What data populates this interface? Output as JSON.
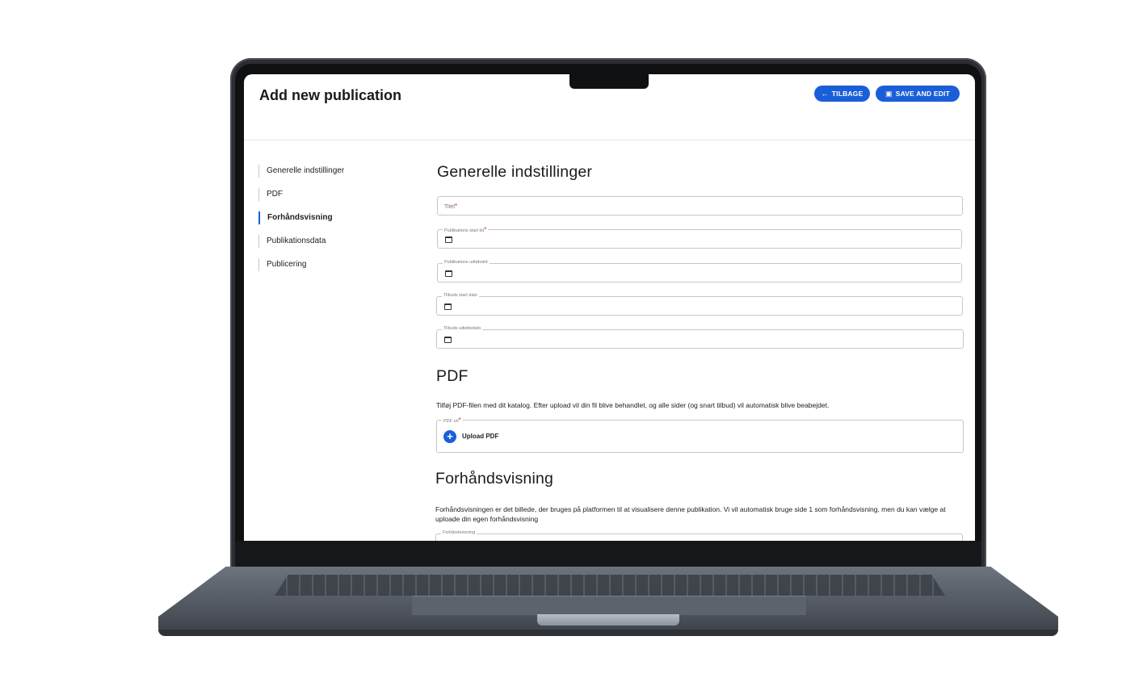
{
  "header": {
    "title": "Add new publication",
    "back_label": "TILBAGE",
    "back_icon": "arrow-left-icon",
    "save_label": "SAVE AND EDIT",
    "save_icon": "save-icon"
  },
  "sidebar": {
    "items": [
      {
        "label": "Generelle indstillinger",
        "active": false
      },
      {
        "label": "PDF",
        "active": false
      },
      {
        "label": "Forhåndsvisning",
        "active": true
      },
      {
        "label": "Publikationsdata",
        "active": false
      },
      {
        "label": "Publicering",
        "active": false
      }
    ]
  },
  "general": {
    "heading": "Generelle indstillinger",
    "title_placeholder": "Titel",
    "start_label": "Publikations start tid",
    "end_label": "Publikations udløbstid",
    "offer_start_label": "Tilbuds start dato",
    "offer_end_label": "Tilbuds udløbsdato",
    "required_mark": "*"
  },
  "pdf": {
    "heading": "PDF",
    "description": "Tilføj PDF-filen med dit katalog. Efter upload vil din fil blive behandlet, og alle sider (og snart tilbud) vil automatisk blive beabejdet.",
    "url_label": "PDF url",
    "upload_label": "Upload PDF"
  },
  "preview": {
    "heading": "Forhåndsvisning",
    "description": "Forhåndsvisningen er det billede, der bruges på platformen til at visualisere denne publikation. Vi vil automatisk bruge side 1 som forhåndsvisning, men du kan vælge at uploade din egen forhåndsvisning",
    "field_label": "Forhåndsvisning"
  },
  "colors": {
    "accent": "#1a5fd8",
    "required": "#d52b2b"
  }
}
